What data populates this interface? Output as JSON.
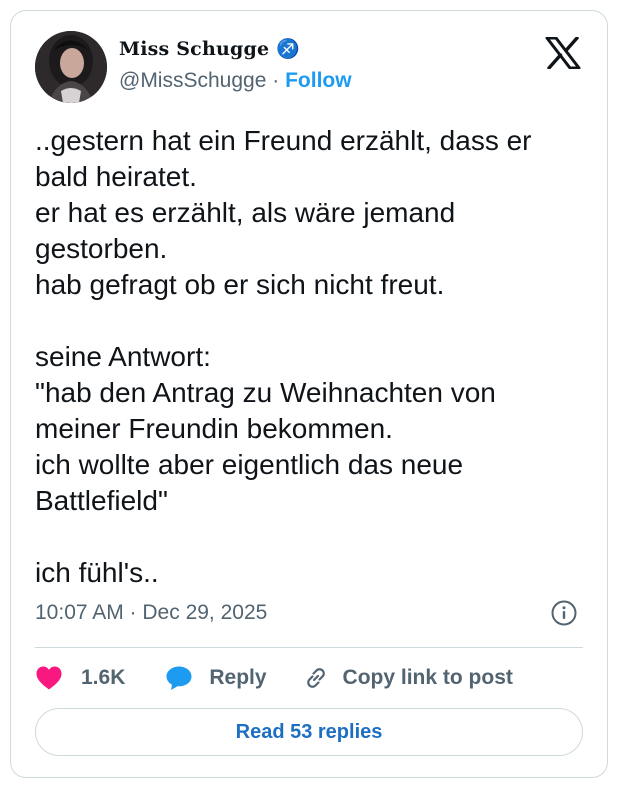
{
  "author": {
    "display_name": "Miss Schugge",
    "name_emoji": "♐",
    "handle": "@MissSchugge",
    "separator": "·",
    "follow_label": "Follow"
  },
  "tweet": {
    "paragraphs": [
      {
        "lines": [
          "..gestern hat ein Freund erzählt, dass er",
          "bald heiratet.",
          "er hat es erzählt, als wäre jemand",
          "gestorben.",
          "hab gefragt ob er sich nicht freut."
        ]
      },
      {
        "lines": [
          "seine Antwort:",
          "\"hab den Antrag zu Weihnachten von",
          "meiner Freundin bekommen.",
          "ich wollte aber eigentlich das neue",
          "Battlefield\""
        ]
      },
      {
        "lines": [
          "ich fühl's.."
        ]
      }
    ],
    "timestamp": "10:07 AM · Dec 29, 2025"
  },
  "actions": {
    "like_count": "1.6K",
    "reply_label": "Reply",
    "copy_label": "Copy link to post"
  },
  "read_replies_label": "Read 53 replies",
  "colors": {
    "accent": "#1d9bf0",
    "like": "#f91880",
    "muted": "#536471",
    "border": "#cfd9de"
  }
}
